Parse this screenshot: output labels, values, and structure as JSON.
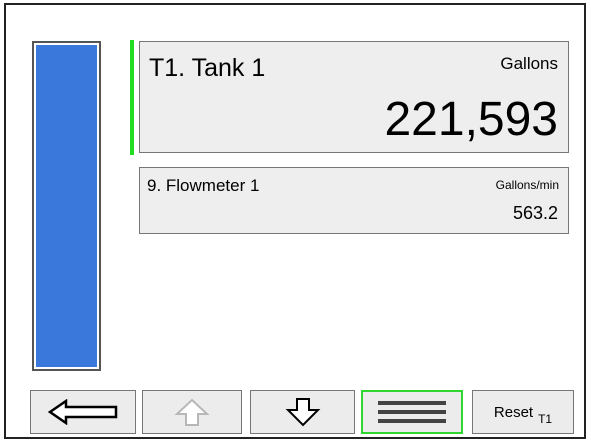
{
  "tank": {
    "level_fraction": 1.0,
    "title": "T1. Tank 1",
    "unit": "Gallons",
    "value": "221,593"
  },
  "flow": {
    "title": "9. Flowmeter 1",
    "unit": "Gallons/min",
    "value": "563.2"
  },
  "buttons": {
    "reset_label": "Reset",
    "reset_target": "T1"
  },
  "colors": {
    "level_fill": "#3b78dc",
    "accent": "#22dd22",
    "selected_border": "#2fd62f",
    "card_bg": "#eeeeee"
  },
  "icons": {
    "left": "left-arrow-icon",
    "up": "up-arrow-icon",
    "down": "down-arrow-icon",
    "menu": "menu-icon"
  }
}
